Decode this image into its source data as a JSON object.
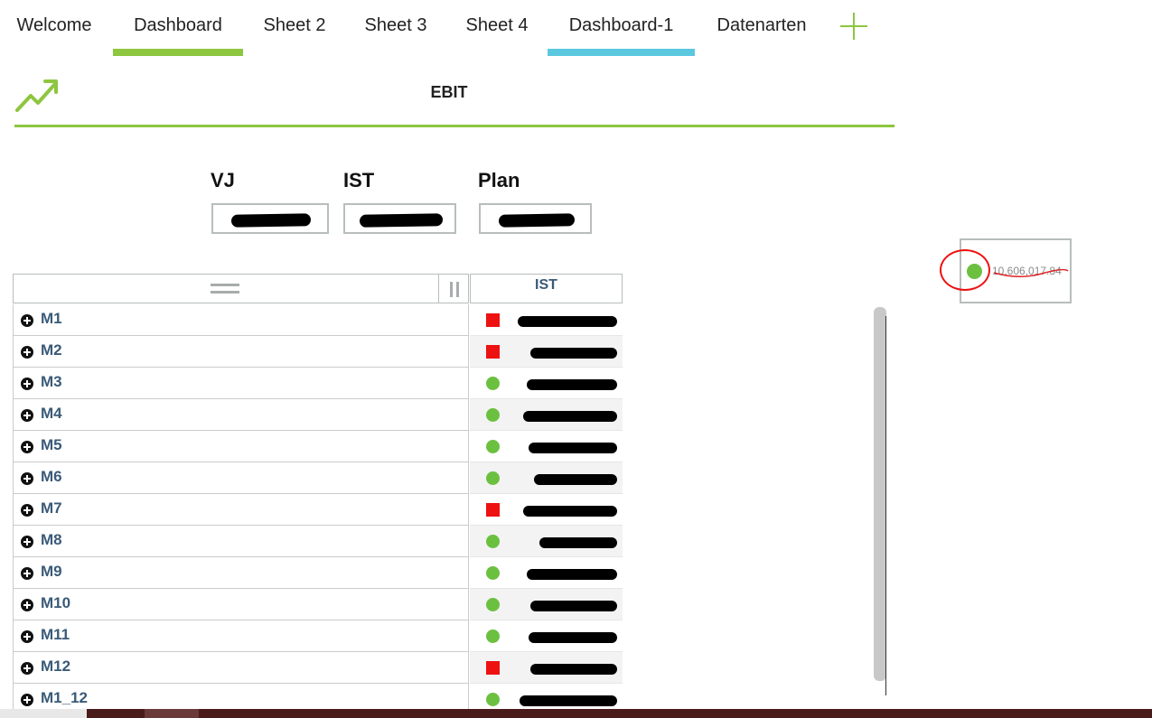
{
  "tabs": [
    {
      "label": "Welcome"
    },
    {
      "label": "Dashboard"
    },
    {
      "label": "Sheet 2"
    },
    {
      "label": "Sheet 3"
    },
    {
      "label": "Sheet 4"
    },
    {
      "label": "Dashboard-1"
    },
    {
      "label": "Datenarten"
    }
  ],
  "colors": {
    "accent_green": "#8dc63f",
    "accent_blue": "#5bc8e0",
    "status_red": "#ee1111",
    "status_green": "#6cc040",
    "link_blue": "#3a5a78"
  },
  "header": {
    "title": "EBIT",
    "icon": "trend-up-icon"
  },
  "kpis": {
    "vj_label": "VJ",
    "ist_label": "IST",
    "plan_label": "Plan"
  },
  "table": {
    "column_header": "IST",
    "rows": [
      {
        "label": "M1",
        "status": "red"
      },
      {
        "label": "M2",
        "status": "red"
      },
      {
        "label": "M3",
        "status": "green"
      },
      {
        "label": "M4",
        "status": "green"
      },
      {
        "label": "M5",
        "status": "green"
      },
      {
        "label": "M6",
        "status": "green"
      },
      {
        "label": "M7",
        "status": "red"
      },
      {
        "label": "M8",
        "status": "green"
      },
      {
        "label": "M9",
        "status": "green"
      },
      {
        "label": "M10",
        "status": "green"
      },
      {
        "label": "M11",
        "status": "green"
      },
      {
        "label": "M12",
        "status": "red"
      },
      {
        "label": "M1_12",
        "status": "green"
      }
    ]
  },
  "side_card": {
    "value": "10,606,017.84"
  }
}
